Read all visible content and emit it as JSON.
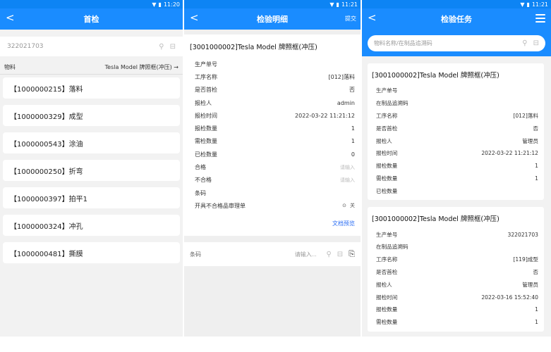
{
  "status": {
    "time1": "11:20",
    "time2": "11:21",
    "time3": "11:21"
  },
  "screen1": {
    "title": "首检",
    "search_value": "322021703",
    "material_label": "物料",
    "material_value": "Tesla Model 牌照框(冲压) →",
    "processes": [
      "【1000000215】落料",
      "【1000000329】成型",
      "【1000000543】涂油",
      "【1000000250】折弯",
      "【1000000397】拍平1",
      "【1000000324】冲孔",
      "【1000000481】撕膜"
    ]
  },
  "screen2": {
    "title": "检验明细",
    "submit_label": "提交",
    "header": "[3001000002]Tesla Model 牌照框(冲压)",
    "rows": [
      {
        "k": "生产单号",
        "v": ""
      },
      {
        "k": "工序名称",
        "v": "[012]落料"
      },
      {
        "k": "是否首检",
        "v": "否"
      },
      {
        "k": "报检人",
        "v": "admin"
      },
      {
        "k": "报检时间",
        "v": "2022-03-22 11:21:12"
      },
      {
        "k": "报检数量",
        "v": "1"
      },
      {
        "k": "需检数量",
        "v": "1"
      },
      {
        "k": "已检数量",
        "v": "0"
      }
    ],
    "ok_label": "合格",
    "ok_placeholder": "请输入",
    "ng_label": "不合格",
    "ng_placeholder": "请输入",
    "barcode_row_label": "条码",
    "review_label": "开具不合格品审理单",
    "switch_state": "关",
    "doc_preview": "文档预览",
    "barcode_label": "条码",
    "barcode_placeholder": "请输入..."
  },
  "screen3": {
    "title": "检验任务",
    "search_placeholder": "物料名称/在制品追溯码",
    "cards": [
      {
        "header": "[3001000002]Tesla Model 牌照框(冲压)",
        "rows": [
          {
            "k": "生产单号",
            "v": ""
          },
          {
            "k": "在制品追溯码",
            "v": ""
          },
          {
            "k": "工序名称",
            "v": "[012]落料"
          },
          {
            "k": "是否首检",
            "v": "否"
          },
          {
            "k": "报检人",
            "v": "管理员"
          },
          {
            "k": "报检时间",
            "v": "2022-03-22 11:21:12"
          },
          {
            "k": "报检数量",
            "v": "1"
          },
          {
            "k": "需检数量",
            "v": "1"
          },
          {
            "k": "已检数量",
            "v": ""
          }
        ]
      },
      {
        "header": "[3001000002]Tesla Model 牌照框(冲压)",
        "rows": [
          {
            "k": "生产单号",
            "v": "322021703"
          },
          {
            "k": "在制品追溯码",
            "v": ""
          },
          {
            "k": "工序名称",
            "v": "[119]成型"
          },
          {
            "k": "是否首检",
            "v": "否"
          },
          {
            "k": "报检人",
            "v": "管理员"
          },
          {
            "k": "报检时间",
            "v": "2022-03-16 15:52:40"
          },
          {
            "k": "报检数量",
            "v": "1"
          },
          {
            "k": "需检数量",
            "v": "1"
          }
        ]
      }
    ]
  },
  "colors": {
    "primary": "#1a8cff",
    "link": "#2a6df4"
  }
}
